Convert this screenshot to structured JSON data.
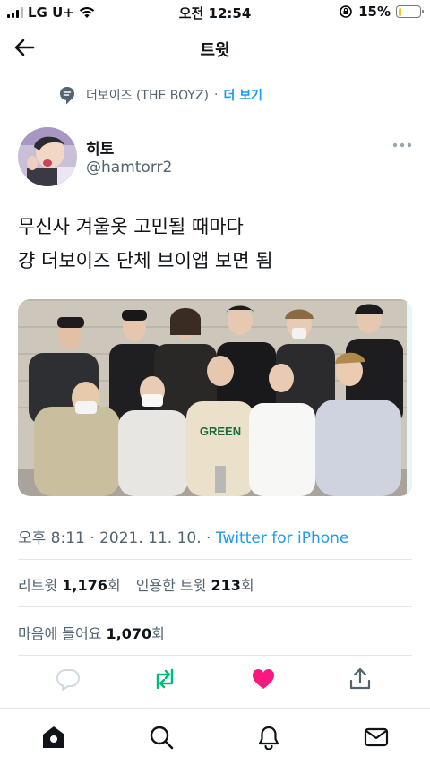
{
  "status": {
    "carrier": "LG U+",
    "time": "오전 12:54",
    "battery": "15%",
    "battery_level": 0.15
  },
  "nav": {
    "title": "트윗"
  },
  "context": {
    "text": "더보이즈 (THE BOYZ)",
    "dot": "·",
    "more": "더 보기"
  },
  "author": {
    "name": "히토",
    "handle": "@hamtorr2"
  },
  "tweet": {
    "line1": "무신사 겨울옷 고민될 때마다",
    "line2": "걍 더보이즈 단체 브이앱 보면 됨"
  },
  "meta": {
    "time": "오후 8:11 · 2021. 11. 10. · ",
    "source": "Twitter for iPhone"
  },
  "stats": {
    "retweet_label": "리트윗 ",
    "retweet_count": "1,176",
    "retweet_unit": "회",
    "quote_label": "인용한 트윗 ",
    "quote_count": "213",
    "quote_unit": "회",
    "like_label": "마음에 들어요 ",
    "like_count": "1,070",
    "like_unit": "회"
  },
  "colors": {
    "accent": "#1d9bf0",
    "retweet": "#00ba7c",
    "like": "#f91880"
  }
}
